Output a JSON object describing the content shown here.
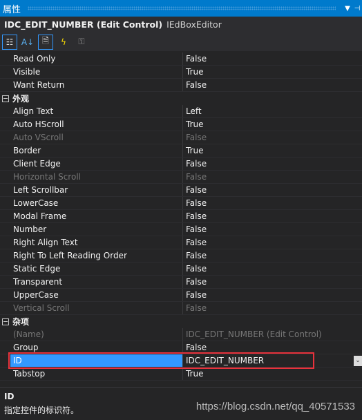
{
  "title": "属性",
  "object": {
    "name": "IDC_EDIT_NUMBER (Edit Control)",
    "type": "IEdBoxEditor"
  },
  "toolbar": [
    "categorized-icon",
    "alphabetical-icon",
    "properties-icon",
    "events-icon",
    "property-pages-icon"
  ],
  "rows_top": [
    {
      "name": "Read Only",
      "value": "False"
    },
    {
      "name": "Visible",
      "value": "True"
    },
    {
      "name": "Want Return",
      "value": "False"
    }
  ],
  "cat1": {
    "label": "外观",
    "rows": [
      {
        "name": "Align Text",
        "value": "Left"
      },
      {
        "name": "Auto HScroll",
        "value": "True"
      },
      {
        "name": "Auto VScroll",
        "value": "False",
        "disabled": true
      },
      {
        "name": "Border",
        "value": "True"
      },
      {
        "name": "Client Edge",
        "value": "False"
      },
      {
        "name": "Horizontal Scroll",
        "value": "False",
        "disabled": true
      },
      {
        "name": "Left Scrollbar",
        "value": "False"
      },
      {
        "name": "LowerCase",
        "value": "False"
      },
      {
        "name": "Modal Frame",
        "value": "False"
      },
      {
        "name": "Number",
        "value": "False"
      },
      {
        "name": "Right Align Text",
        "value": "False"
      },
      {
        "name": "Right To Left Reading Order",
        "value": "False"
      },
      {
        "name": "Static Edge",
        "value": "False"
      },
      {
        "name": "Transparent",
        "value": "False"
      },
      {
        "name": "UpperCase",
        "value": "False"
      },
      {
        "name": "Vertical Scroll",
        "value": "False",
        "disabled": true
      }
    ]
  },
  "cat2": {
    "label": "杂项",
    "rows": [
      {
        "name": "(Name)",
        "value": "IDC_EDIT_NUMBER (Edit Control)",
        "disabled": true
      },
      {
        "name": "Group",
        "value": "False"
      },
      {
        "name": "ID",
        "value": "IDC_EDIT_NUMBER",
        "selected": true
      },
      {
        "name": "Tabstop",
        "value": "True"
      }
    ]
  },
  "footer": {
    "title": "ID",
    "description": "指定控件的标识符。"
  },
  "watermark": "https://blog.csdn.net/qq_40571533"
}
